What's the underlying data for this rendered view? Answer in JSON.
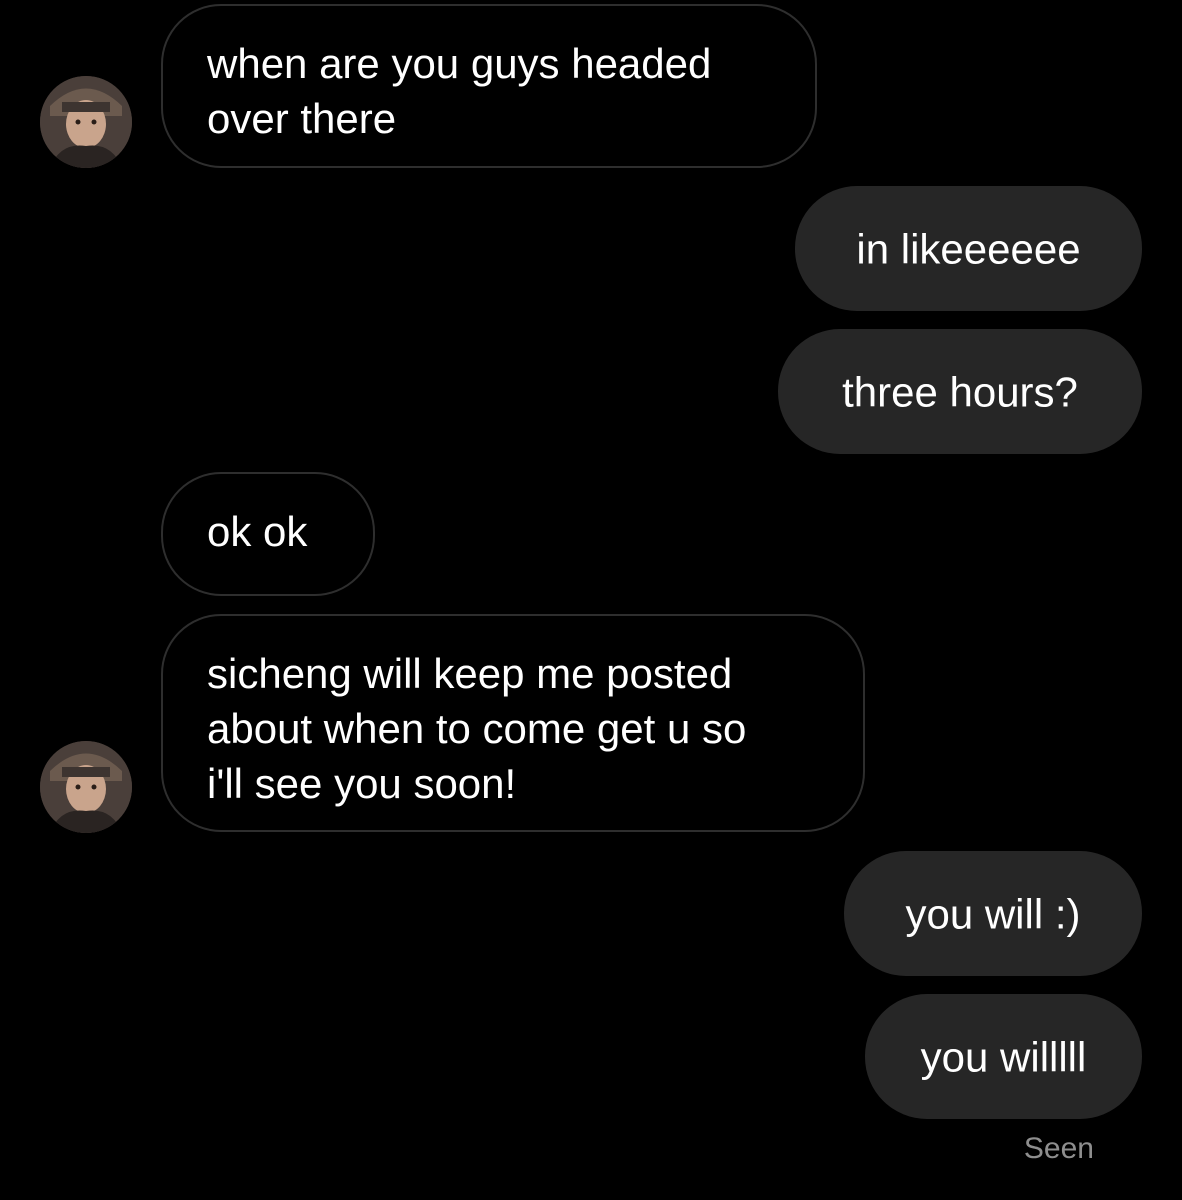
{
  "conversation": {
    "messages": [
      {
        "from": "them",
        "text_lines": [
          "when are you guys headed",
          "over there"
        ]
      },
      {
        "from": "me",
        "text": "in likeeeeee"
      },
      {
        "from": "me",
        "text": "three hours?"
      },
      {
        "from": "them",
        "text_lines": [
          "ok ok"
        ]
      },
      {
        "from": "them",
        "text_lines": [
          "sicheng will keep me posted",
          "about when to come get u so",
          "i'll see you soon!"
        ]
      },
      {
        "from": "me",
        "text": "you will :)"
      },
      {
        "from": "me",
        "text": "you willlll"
      }
    ],
    "status": "Seen"
  },
  "theme": {
    "background": "#000000",
    "outgoing_bubble": "#262626",
    "incoming_border": "#2e2e2e",
    "text": "#ffffff",
    "status_text": "#8e8e8e"
  }
}
